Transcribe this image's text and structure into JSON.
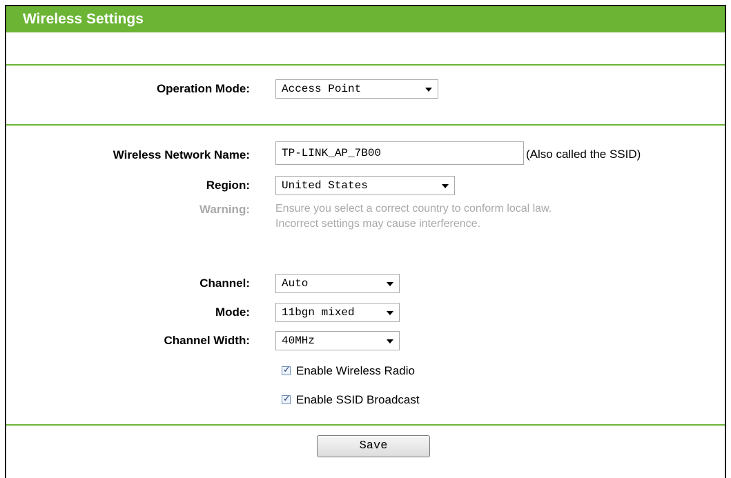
{
  "header": {
    "title": "Wireless Settings"
  },
  "operation_mode": {
    "label": "Operation Mode:",
    "value": "Access Point"
  },
  "network_name": {
    "label": "Wireless Network Name:",
    "value": "TP-LINK_AP_7B00",
    "note": "(Also called the SSID)"
  },
  "region": {
    "label": "Region:",
    "value": "United States"
  },
  "warning": {
    "label": "Warning:",
    "line1": "Ensure you select a correct country to conform local law.",
    "line2": "Incorrect settings may cause interference."
  },
  "channel": {
    "label": "Channel:",
    "value": "Auto"
  },
  "mode": {
    "label": "Mode:",
    "value": "11bgn mixed"
  },
  "channel_width": {
    "label": "Channel Width:",
    "value": "40MHz"
  },
  "enable_wireless_radio": {
    "label": "Enable Wireless Radio",
    "checked": true
  },
  "enable_ssid_broadcast": {
    "label": "Enable SSID Broadcast",
    "checked": true
  },
  "save": {
    "label": "Save"
  },
  "colors": {
    "accent": "#6bb434",
    "warning_text": "#a8a8a8"
  }
}
